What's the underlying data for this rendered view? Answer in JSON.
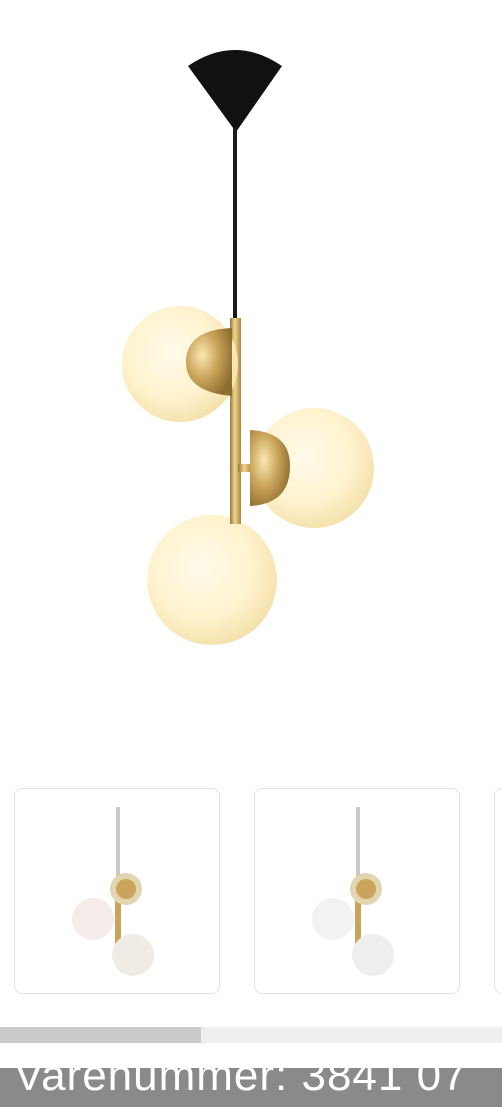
{
  "product": {
    "image_name": "pendant-lamp-three-globes",
    "colors": {
      "canopy": "#111111",
      "cord": "#1a1a1a",
      "brass": "#c9a45a",
      "globe_warm": "#fff3cf",
      "globe_white": "#f5f1ee"
    }
  },
  "thumbnails": [
    {
      "name": "thumbnail-1",
      "variant": "white-globes-brass"
    },
    {
      "name": "thumbnail-2",
      "variant": "white-globes-brass"
    },
    {
      "name": "thumbnail-3",
      "variant": "partially-visible"
    }
  ],
  "carousel": {
    "scroll_fraction": 0.4
  },
  "bottom_banner": {
    "text": "Varenummer: 3841 07"
  }
}
